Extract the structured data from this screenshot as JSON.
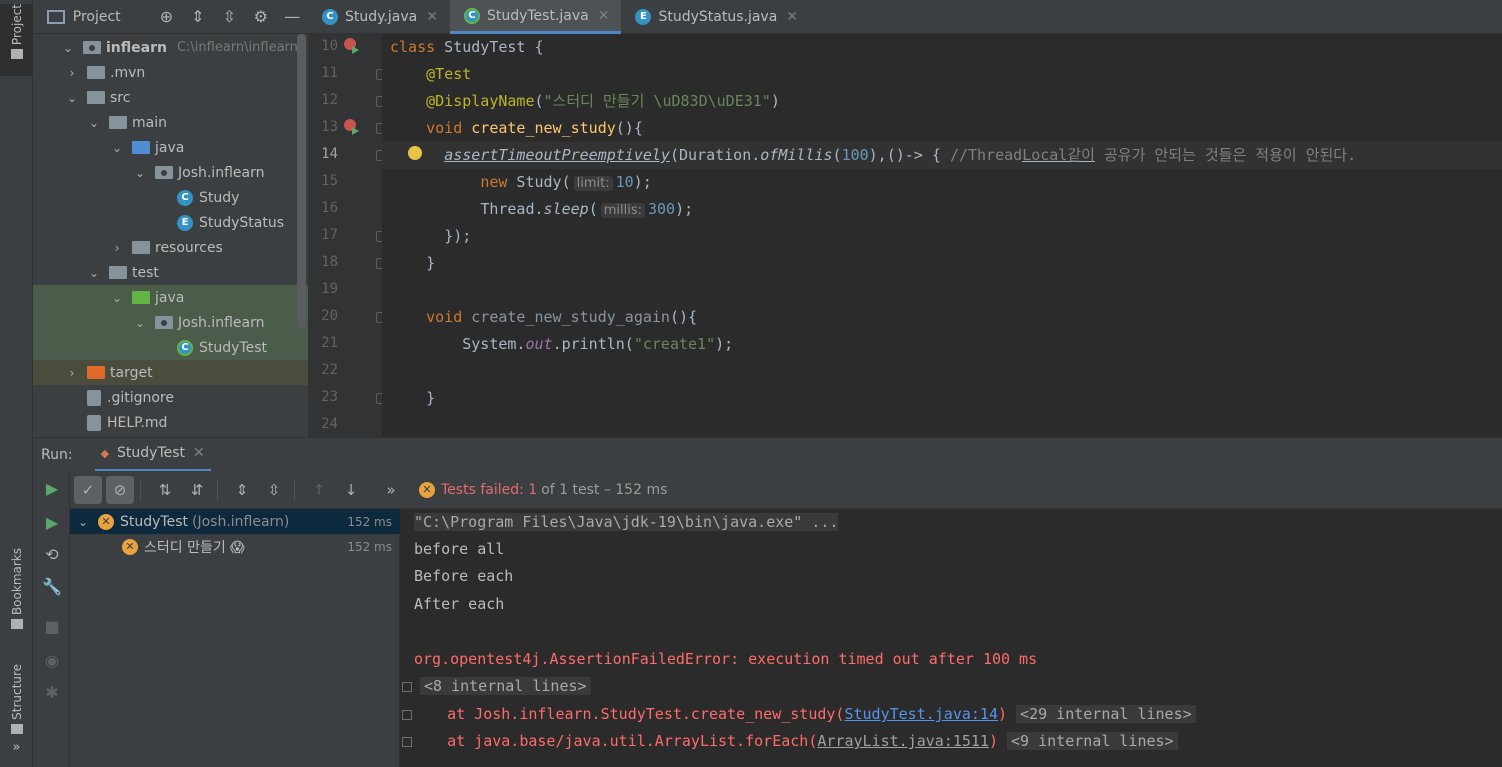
{
  "left_strip": {
    "project_tab": "Project",
    "bookmarks_tab": "Bookmarks",
    "structure_tab": "Structure",
    "expand": "»"
  },
  "project_panel": {
    "title": "Project",
    "tree": [
      {
        "label": "inflearn",
        "hint": "C:\\inflearn\\inflearn",
        "indent": 0,
        "chevron": "⌄",
        "icon": "folder-pkg"
      },
      {
        "label": ".mvn",
        "indent": 1,
        "chevron": "›",
        "icon": "folder"
      },
      {
        "label": "src",
        "indent": 1,
        "chevron": "⌄",
        "icon": "folder"
      },
      {
        "label": "main",
        "indent": 2,
        "chevron": "⌄",
        "icon": "folder"
      },
      {
        "label": "java",
        "indent": 3,
        "chevron": "⌄",
        "icon": "folder-blue"
      },
      {
        "label": "Josh.inflearn",
        "indent": 4,
        "chevron": "⌄",
        "icon": "folder-pkg"
      },
      {
        "label": "Study",
        "indent": 5,
        "chevron": "",
        "icon": "class"
      },
      {
        "label": "StudyStatus",
        "indent": 5,
        "chevron": "",
        "icon": "enum"
      },
      {
        "label": "resources",
        "indent": 3,
        "chevron": "›",
        "icon": "folder"
      },
      {
        "label": "test",
        "indent": 2,
        "chevron": "⌄",
        "icon": "folder"
      },
      {
        "label": "java",
        "indent": 3,
        "chevron": "⌄",
        "icon": "folder-green"
      },
      {
        "label": "Josh.inflearn",
        "indent": 4,
        "chevron": "⌄",
        "icon": "folder-pkg"
      },
      {
        "label": "StudyTest",
        "indent": 5,
        "chevron": "",
        "icon": "test"
      },
      {
        "label": "target",
        "indent": 1,
        "chevron": "›",
        "icon": "folder-orange"
      },
      {
        "label": ".gitignore",
        "indent": 1,
        "chevron": "",
        "icon": "doc"
      },
      {
        "label": "HELP.md",
        "indent": 1,
        "chevron": "",
        "icon": "doc"
      }
    ]
  },
  "editor_tabs": [
    {
      "label": "Study.java",
      "active": false,
      "icon": "C"
    },
    {
      "label": "StudyTest.java",
      "active": true,
      "icon": "C"
    },
    {
      "label": "StudyStatus.java",
      "active": false,
      "icon": "E"
    }
  ],
  "editor": {
    "line_numbers": [
      "10",
      "11",
      "12",
      "13",
      "14",
      "15",
      "16",
      "17",
      "18",
      "19",
      "20",
      "21",
      "22",
      "23",
      "24"
    ],
    "current_line": "14",
    "code": {
      "l10_kw": "class",
      "l10_rest": " StudyTest {",
      "l11_ann": "@Test",
      "l12_ann": "@DisplayName",
      "l12_open": "(",
      "l12_str": "\"스터디 만들기 \\uD83D\\uDE31\"",
      "l12_close": ")",
      "l13_kw": "void",
      "l13_fn": " create_new_study",
      "l13_rest": "(){",
      "l14_fn": "assertTimeoutPreemptively",
      "l14_a": "(Duration.",
      "l14_static": "ofMillis",
      "l14_b": "(",
      "l14_num": "100",
      "l14_c": "),()-> { ",
      "l14_cmt_a": "//Thread",
      "l14_cmt_u": "Local같이",
      "l14_cmt_b": " 공유가 안되는 것들은 적용이 안된다.",
      "l15_kw": "new",
      "l15_a": " Study(",
      "l15_hint": "limit:",
      "l15_num": "10",
      "l15_b": ");",
      "l16_a": "Thread.",
      "l16_static": "sleep",
      "l16_b": "(",
      "l16_hint": "millis:",
      "l16_num": "300",
      "l16_c": ");",
      "l17": "});",
      "l18": "}",
      "l20_kw": "void",
      "l20_fn": " create_new_study_again",
      "l20_rest": "(){",
      "l21_a": "System.",
      "l21_out": "out",
      "l21_b": ".println(",
      "l21_str": "\"create1\"",
      "l21_c": ");",
      "l23": "}"
    }
  },
  "run_panel": {
    "label": "Run:",
    "tab": "StudyTest",
    "status": {
      "failed": "Tests failed: 1",
      "rest": "of 1 test – 152 ms"
    },
    "tests": [
      {
        "name": "StudyTest",
        "pkg": "(Josh.inflearn)",
        "time": "152 ms"
      },
      {
        "name": "스터디 만들기 😱",
        "time": "152 ms"
      }
    ],
    "console": {
      "cmd": "\"C:\\Program Files\\Java\\jdk-19\\bin\\java.exe\" ...",
      "l1": "before all",
      "l2": "Before each",
      "l3": "After each",
      "error": "org.opentest4j.AssertionFailedError: execution timed out after 100 ms",
      "internal1": "<8 internal lines>",
      "at1_a": "at Josh.inflearn.StudyTest.create_new_study(",
      "at1_link": "StudyTest.java:14",
      "at1_b": ")",
      "internal2": "<29 internal lines>",
      "at2_a": "at java.base/java.util.ArrayList.forEach(",
      "at2_link": "ArrayList.java:1511",
      "at2_b": ")",
      "internal3": "<9 internal lines>"
    }
  },
  "colors": {
    "bg": "#2b2b2b",
    "panel": "#3c3f41",
    "keyword": "#cc7832",
    "annotation": "#bbb529",
    "string": "#6a8759",
    "number": "#6897bb",
    "error": "#ff6b68",
    "link": "#5394ec"
  }
}
